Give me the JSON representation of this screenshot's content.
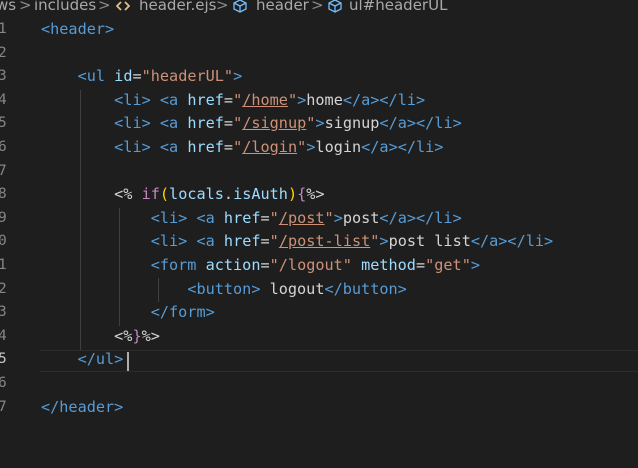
{
  "breadcrumb": {
    "items": [
      "ws",
      "includes",
      "header.ejs",
      "header",
      "ul#headerUL"
    ],
    "separator": ">"
  },
  "editor": {
    "line_numbers": [
      "1",
      "2",
      "3",
      "4",
      "5",
      "6",
      "7",
      "8",
      "9",
      "0",
      "1",
      "2",
      "3",
      "4",
      "5",
      "6",
      "7"
    ],
    "active_line_index": 14,
    "lines": [
      [
        {
          "c": "t",
          "x": "<header>"
        }
      ],
      [],
      [
        {
          "c": "w",
          "x": "    "
        },
        {
          "c": "t",
          "x": "<ul"
        },
        {
          "c": "w",
          "x": " "
        },
        {
          "c": "a",
          "x": "id"
        },
        {
          "c": "w",
          "x": "="
        },
        {
          "c": "s",
          "x": "\"headerUL\""
        },
        {
          "c": "t",
          "x": ">"
        }
      ],
      [
        {
          "c": "w",
          "x": "        "
        },
        {
          "c": "t",
          "x": "<li>"
        },
        {
          "c": "w",
          "x": " "
        },
        {
          "c": "t",
          "x": "<a"
        },
        {
          "c": "w",
          "x": " "
        },
        {
          "c": "a",
          "x": "href"
        },
        {
          "c": "w",
          "x": "="
        },
        {
          "c": "s",
          "x": "\""
        },
        {
          "c": "u",
          "x": "/home"
        },
        {
          "c": "s",
          "x": "\""
        },
        {
          "c": "t",
          "x": ">"
        },
        {
          "c": "w",
          "x": "home"
        },
        {
          "c": "t",
          "x": "</a></li>"
        }
      ],
      [
        {
          "c": "w",
          "x": "        "
        },
        {
          "c": "t",
          "x": "<li>"
        },
        {
          "c": "w",
          "x": " "
        },
        {
          "c": "t",
          "x": "<a"
        },
        {
          "c": "w",
          "x": " "
        },
        {
          "c": "a",
          "x": "href"
        },
        {
          "c": "w",
          "x": "="
        },
        {
          "c": "s",
          "x": "\""
        },
        {
          "c": "u",
          "x": "/signup"
        },
        {
          "c": "s",
          "x": "\""
        },
        {
          "c": "t",
          "x": ">"
        },
        {
          "c": "w",
          "x": "signup"
        },
        {
          "c": "t",
          "x": "</a></li>"
        }
      ],
      [
        {
          "c": "w",
          "x": "        "
        },
        {
          "c": "t",
          "x": "<li>"
        },
        {
          "c": "w",
          "x": " "
        },
        {
          "c": "t",
          "x": "<a"
        },
        {
          "c": "w",
          "x": " "
        },
        {
          "c": "a",
          "x": "href"
        },
        {
          "c": "w",
          "x": "="
        },
        {
          "c": "s",
          "x": "\""
        },
        {
          "c": "u",
          "x": "/login"
        },
        {
          "c": "s",
          "x": "\""
        },
        {
          "c": "t",
          "x": ">"
        },
        {
          "c": "w",
          "x": "login"
        },
        {
          "c": "t",
          "x": "</a></li>"
        }
      ],
      [],
      [
        {
          "c": "w",
          "x": "        "
        },
        {
          "c": "w",
          "x": "<% "
        },
        {
          "c": "k",
          "x": "if"
        },
        {
          "c": "b",
          "x": "("
        },
        {
          "c": "v",
          "x": "locals"
        },
        {
          "c": "w",
          "x": "."
        },
        {
          "c": "v",
          "x": "isAuth"
        },
        {
          "c": "b",
          "x": ")"
        },
        {
          "c": "k",
          "x": "{"
        },
        {
          "c": "w",
          "x": "%>"
        }
      ],
      [
        {
          "c": "w",
          "x": "            "
        },
        {
          "c": "t",
          "x": "<li>"
        },
        {
          "c": "w",
          "x": " "
        },
        {
          "c": "t",
          "x": "<a"
        },
        {
          "c": "w",
          "x": " "
        },
        {
          "c": "a",
          "x": "href"
        },
        {
          "c": "w",
          "x": "="
        },
        {
          "c": "s",
          "x": "\""
        },
        {
          "c": "u",
          "x": "/post"
        },
        {
          "c": "s",
          "x": "\""
        },
        {
          "c": "t",
          "x": ">"
        },
        {
          "c": "w",
          "x": "post"
        },
        {
          "c": "t",
          "x": "</a></li>"
        }
      ],
      [
        {
          "c": "w",
          "x": "            "
        },
        {
          "c": "t",
          "x": "<li>"
        },
        {
          "c": "w",
          "x": " "
        },
        {
          "c": "t",
          "x": "<a"
        },
        {
          "c": "w",
          "x": " "
        },
        {
          "c": "a",
          "x": "href"
        },
        {
          "c": "w",
          "x": "="
        },
        {
          "c": "s",
          "x": "\""
        },
        {
          "c": "u",
          "x": "/post-list"
        },
        {
          "c": "s",
          "x": "\""
        },
        {
          "c": "t",
          "x": ">"
        },
        {
          "c": "w",
          "x": "post list"
        },
        {
          "c": "t",
          "x": "</a></li>"
        }
      ],
      [
        {
          "c": "w",
          "x": "            "
        },
        {
          "c": "t",
          "x": "<form"
        },
        {
          "c": "w",
          "x": " "
        },
        {
          "c": "a",
          "x": "action"
        },
        {
          "c": "w",
          "x": "="
        },
        {
          "c": "s",
          "x": "\"/logout\""
        },
        {
          "c": "w",
          "x": " "
        },
        {
          "c": "a",
          "x": "method"
        },
        {
          "c": "w",
          "x": "="
        },
        {
          "c": "s",
          "x": "\"get\""
        },
        {
          "c": "t",
          "x": ">"
        }
      ],
      [
        {
          "c": "w",
          "x": "                "
        },
        {
          "c": "t",
          "x": "<button>"
        },
        {
          "c": "w",
          "x": " logout"
        },
        {
          "c": "t",
          "x": "</button>"
        }
      ],
      [
        {
          "c": "w",
          "x": "            "
        },
        {
          "c": "t",
          "x": "</form>"
        }
      ],
      [
        {
          "c": "w",
          "x": "        "
        },
        {
          "c": "w",
          "x": "<%"
        },
        {
          "c": "k",
          "x": "}"
        },
        {
          "c": "w",
          "x": "%>"
        }
      ],
      [
        {
          "c": "w",
          "x": "    "
        },
        {
          "c": "t",
          "x": "</ul>"
        }
      ],
      [],
      [
        {
          "c": "t",
          "x": "</header>"
        }
      ]
    ]
  }
}
